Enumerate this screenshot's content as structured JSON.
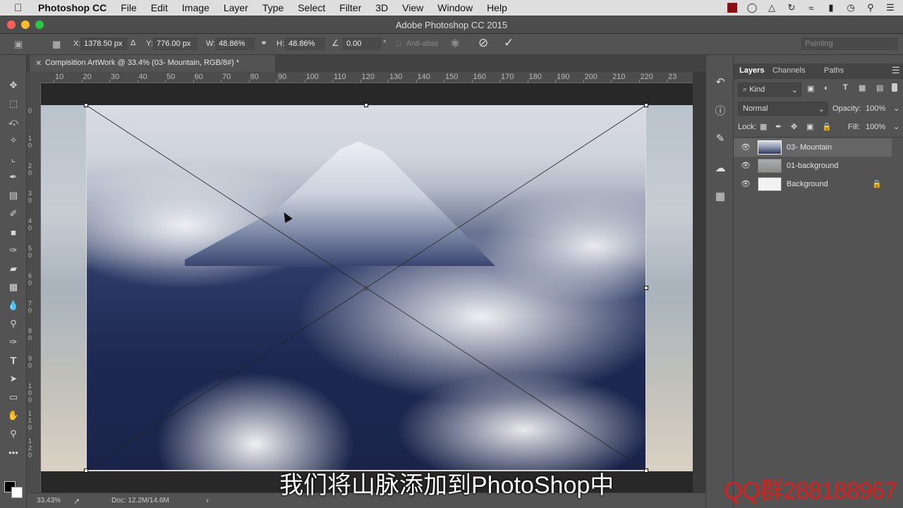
{
  "menubar": {
    "app_name": "Photoshop CC",
    "items": [
      "File",
      "Edit",
      "Image",
      "Layer",
      "Type",
      "Select",
      "Filter",
      "3D",
      "View",
      "Window",
      "Help"
    ]
  },
  "window": {
    "title": "Adobe Photoshop CC 2015"
  },
  "options": {
    "x_label": "X:",
    "x_value": "1378.50 px",
    "y_label": "Y:",
    "y_value": "776.00 px",
    "w_label": "W:",
    "w_value": "48.86%",
    "h_label": "H:",
    "h_value": "48.86%",
    "angle_value": "0.00",
    "angle_unit": "°",
    "antialias_label": "Anti-alias",
    "workspace": "Painting"
  },
  "document": {
    "tab_title": "Compisition ArtWork @ 33.4% (03- Mountain, RGB/8#) *"
  },
  "ruler": {
    "h_labels": [
      "10",
      "20",
      "30",
      "40",
      "50",
      "60",
      "70",
      "80",
      "90",
      "100",
      "110",
      "120",
      "130",
      "140",
      "150",
      "160",
      "170",
      "180",
      "190",
      "200",
      "210",
      "220",
      "23"
    ],
    "v_labels": [
      "0",
      "1\n0",
      "2\n0",
      "3\n0",
      "4\n0",
      "5\n0",
      "6\n0",
      "7\n0",
      "8\n0",
      "9\n0",
      "1\n0\n0",
      "1\n1\n0",
      "1\n2\n0"
    ]
  },
  "status": {
    "zoom": "33.43%",
    "doc": "Doc: 12.2M/14.6M",
    "arrow": "›"
  },
  "subtitle": "我们将山脉添加到PhotoShop中",
  "watermark": "QQ群288188967",
  "layers_panel": {
    "tabs": [
      "Layers",
      "Channels",
      "Paths"
    ],
    "filter_kind": "Kind",
    "blend_mode": "Normal",
    "opacity_label": "Opacity:",
    "opacity_value": "100%",
    "lock_label": "Lock:",
    "fill_label": "Fill:",
    "fill_value": "100%",
    "layers": [
      {
        "name": "03- Mountain",
        "selected": true
      },
      {
        "name": "01-background",
        "selected": false
      },
      {
        "name": "Background",
        "selected": false,
        "locked": true
      }
    ]
  },
  "colors": {
    "accent_selected_layer": "#666666",
    "watermark_red": "#d9201c"
  }
}
